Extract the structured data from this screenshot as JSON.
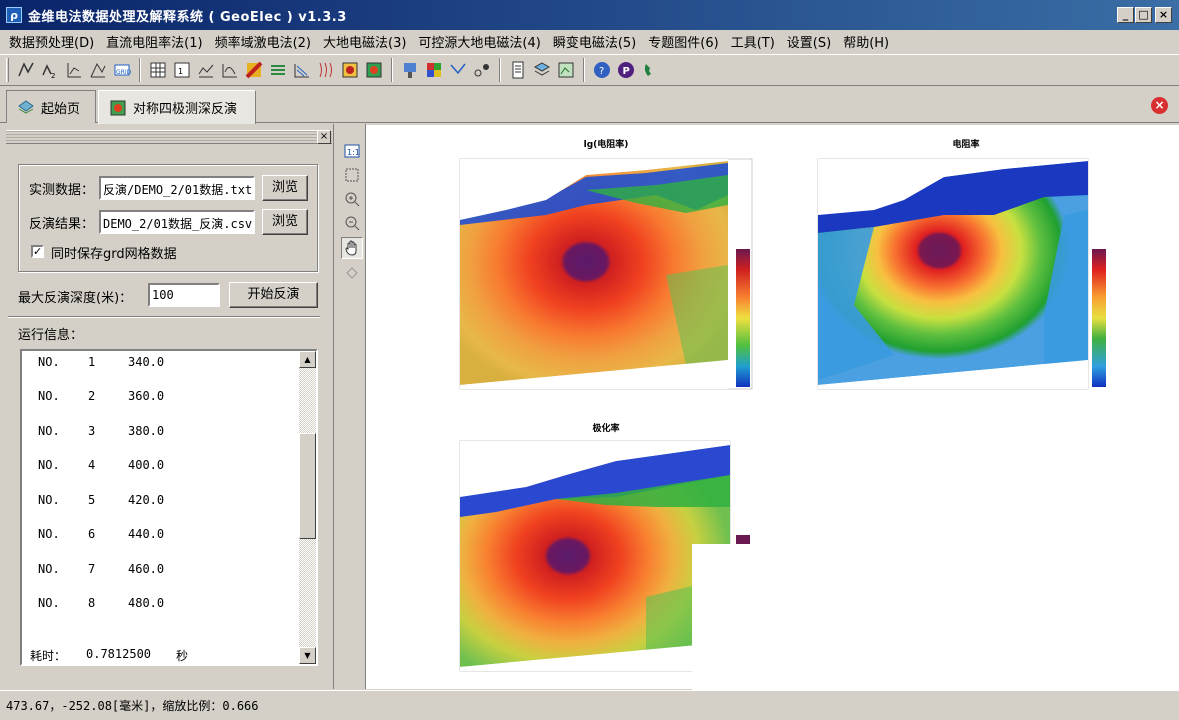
{
  "window": {
    "title": "金维电法数据处理及解释系统 ( GeoElec ) v1.3.3",
    "app_icon": "ρ",
    "min": "_",
    "max": "□",
    "close": "×"
  },
  "menu": [
    "数据预处理(D)",
    "直流电阻率法(1)",
    "频率域激电法(2)",
    "大地电磁法(3)",
    "可控源大地电磁法(4)",
    "瞬变电磁法(5)",
    "专题图件(6)",
    "工具(T)",
    "设置(S)",
    "帮助(H)"
  ],
  "toolbar_icons": [
    "curve-edit-icon",
    "curve-edit2-icon",
    "profile-icon",
    "chart-icon",
    "grid-icon",
    "table-icon",
    "spreadsheet-icon",
    "line-plot-icon",
    "curve-icon",
    "colormap-icon",
    "layers-icon",
    "section-icon",
    "wave-icon",
    "model-icon",
    "model2-icon",
    "tools-icon",
    "palette-icon",
    "line-tool-icon",
    "nodes-icon",
    "document-icon",
    "stack-icon",
    "map-icon",
    "help-icon",
    "p-icon",
    "phone-icon"
  ],
  "tabs": [
    {
      "label": "起始页",
      "icon": "home-icon"
    },
    {
      "label": "对称四极测深反演",
      "icon": "inversion-icon"
    }
  ],
  "tab_close": "×",
  "panel": {
    "close": "×",
    "measured_label": "实测数据：",
    "measured_value": "反演/DEMO_2/01数据.txt",
    "result_label": "反演结果：",
    "result_value": "DEMO_2/01数据_反演.csv",
    "browse": "浏览",
    "checkbox_checked": true,
    "checkbox_mark": "✓",
    "checkbox_label": "同时保存grd网格数据",
    "depth_label": "最大反演深度(米)：",
    "depth_value": "100",
    "start_button": "开始反演",
    "run_info_label": "运行信息：",
    "log": [
      [
        "NO.",
        "1",
        "340.0"
      ],
      [
        "NO.",
        "2",
        "360.0"
      ],
      [
        "NO.",
        "3",
        "380.0"
      ],
      [
        "NO.",
        "4",
        "400.0"
      ],
      [
        "NO.",
        "5",
        "420.0"
      ],
      [
        "NO.",
        "6",
        "440.0"
      ],
      [
        "NO.",
        "7",
        "460.0"
      ],
      [
        "NO.",
        "8",
        "480.0"
      ]
    ],
    "time_label": "耗时：",
    "time_value": "0.7812500",
    "time_unit": "秒"
  },
  "plots": [
    {
      "title": "lg(电阻率)",
      "colormap": "red-hot"
    },
    {
      "title": "电阻率",
      "colormap": "blue-green-red"
    },
    {
      "title": "极化率",
      "colormap": "red-hot"
    }
  ],
  "status": "473.67，-252.08[毫米]，缩放比例：0.666"
}
